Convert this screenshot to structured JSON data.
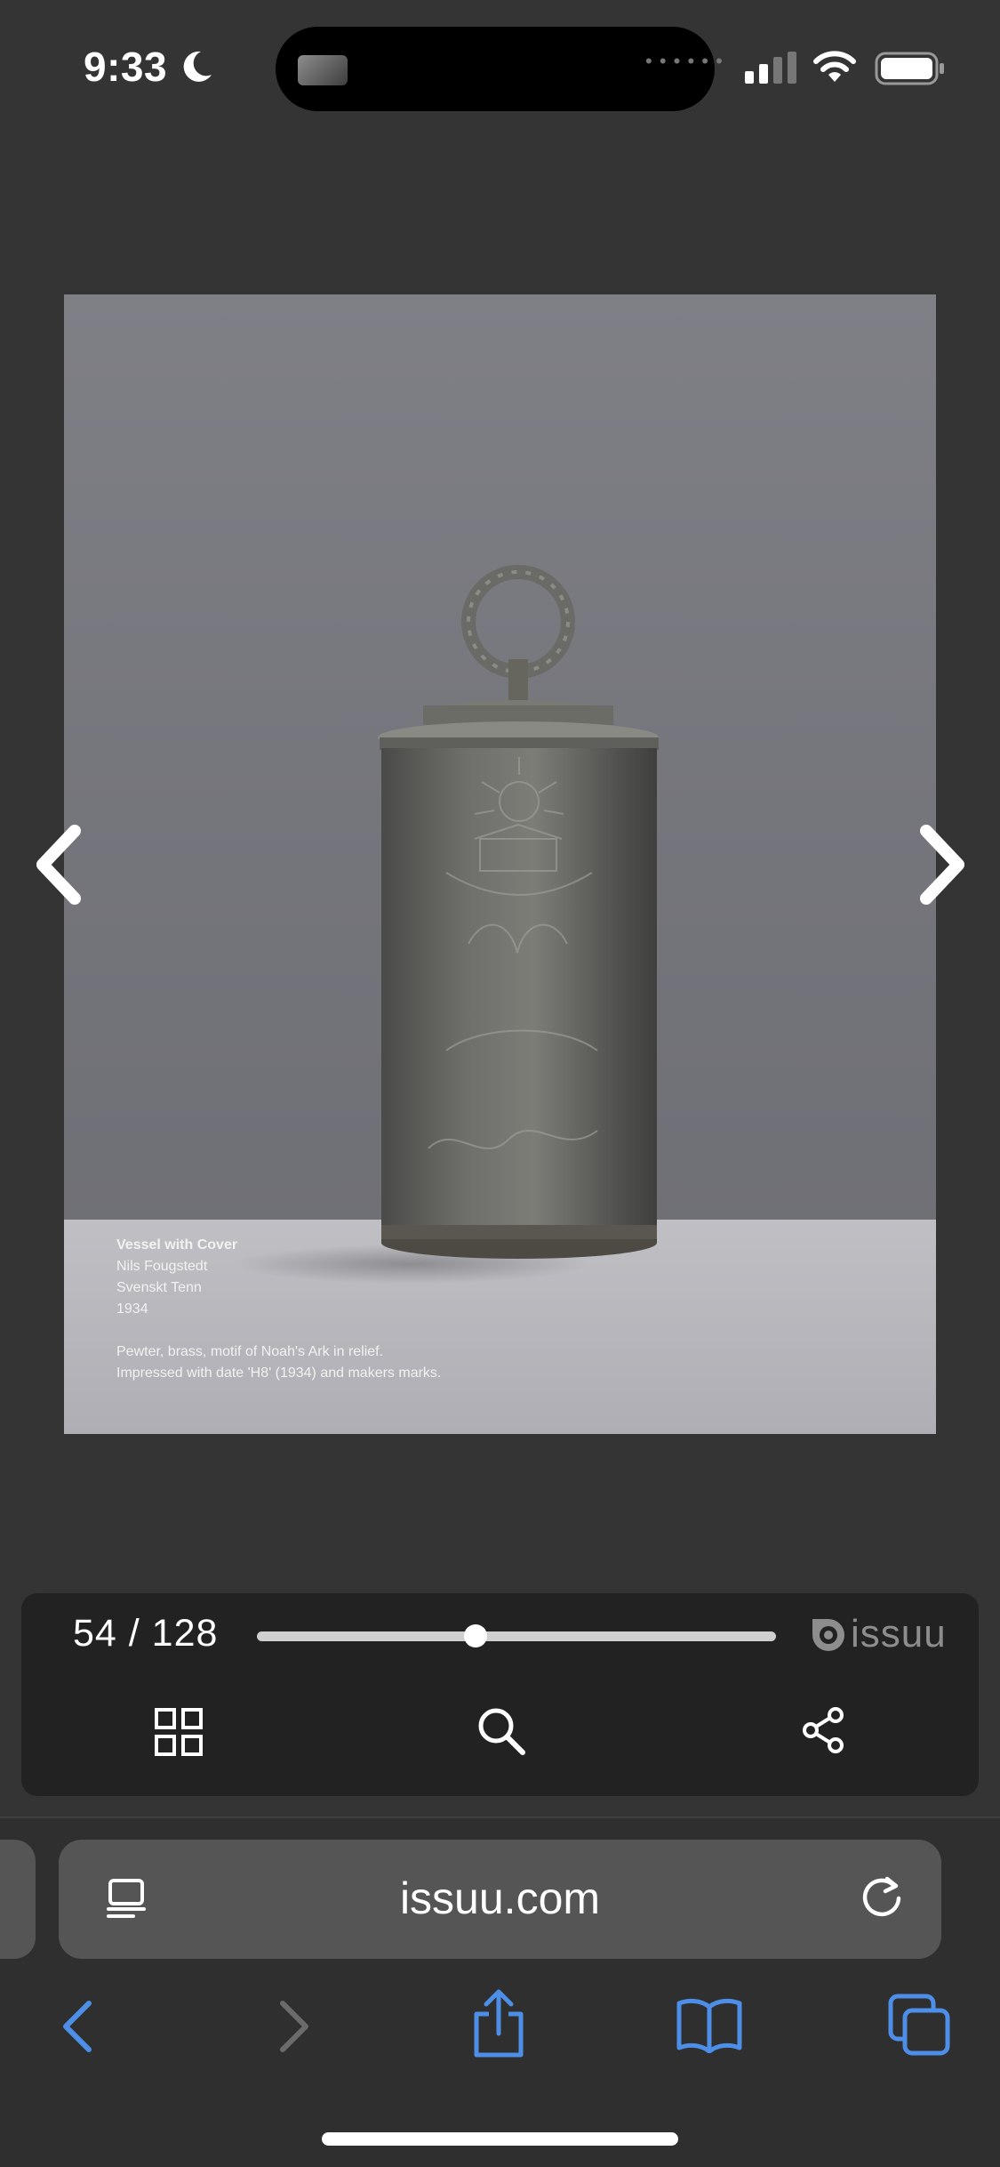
{
  "status_bar": {
    "time": "9:33",
    "icons": [
      "moon-icon",
      "signal-icon",
      "wifi-icon",
      "battery-icon"
    ]
  },
  "viewer": {
    "caption": {
      "title": "Vessel with Cover",
      "artist": "Nils Fougstedt",
      "maker": "Svenskt Tenn",
      "year": "1934",
      "description_line1": "Pewter, brass, motif of Noah's Ark in relief.",
      "description_line2": "Impressed with date 'H8' (1934) and makers marks."
    },
    "page_counter": "54 / 128",
    "current_page": 54,
    "total_pages": 128,
    "brand": "issuu",
    "actions": [
      "grid-icon",
      "search-icon",
      "share-icon"
    ]
  },
  "browser": {
    "url": "issuu.com",
    "toolbar_icons": [
      "back-icon",
      "forward-icon",
      "share-icon",
      "bookmarks-icon",
      "tabs-icon"
    ]
  },
  "colors": {
    "background": "#343434",
    "controls_panel": "#222222",
    "safari_accent": "#4d8fe8",
    "disabled": "#6b6b6b"
  }
}
